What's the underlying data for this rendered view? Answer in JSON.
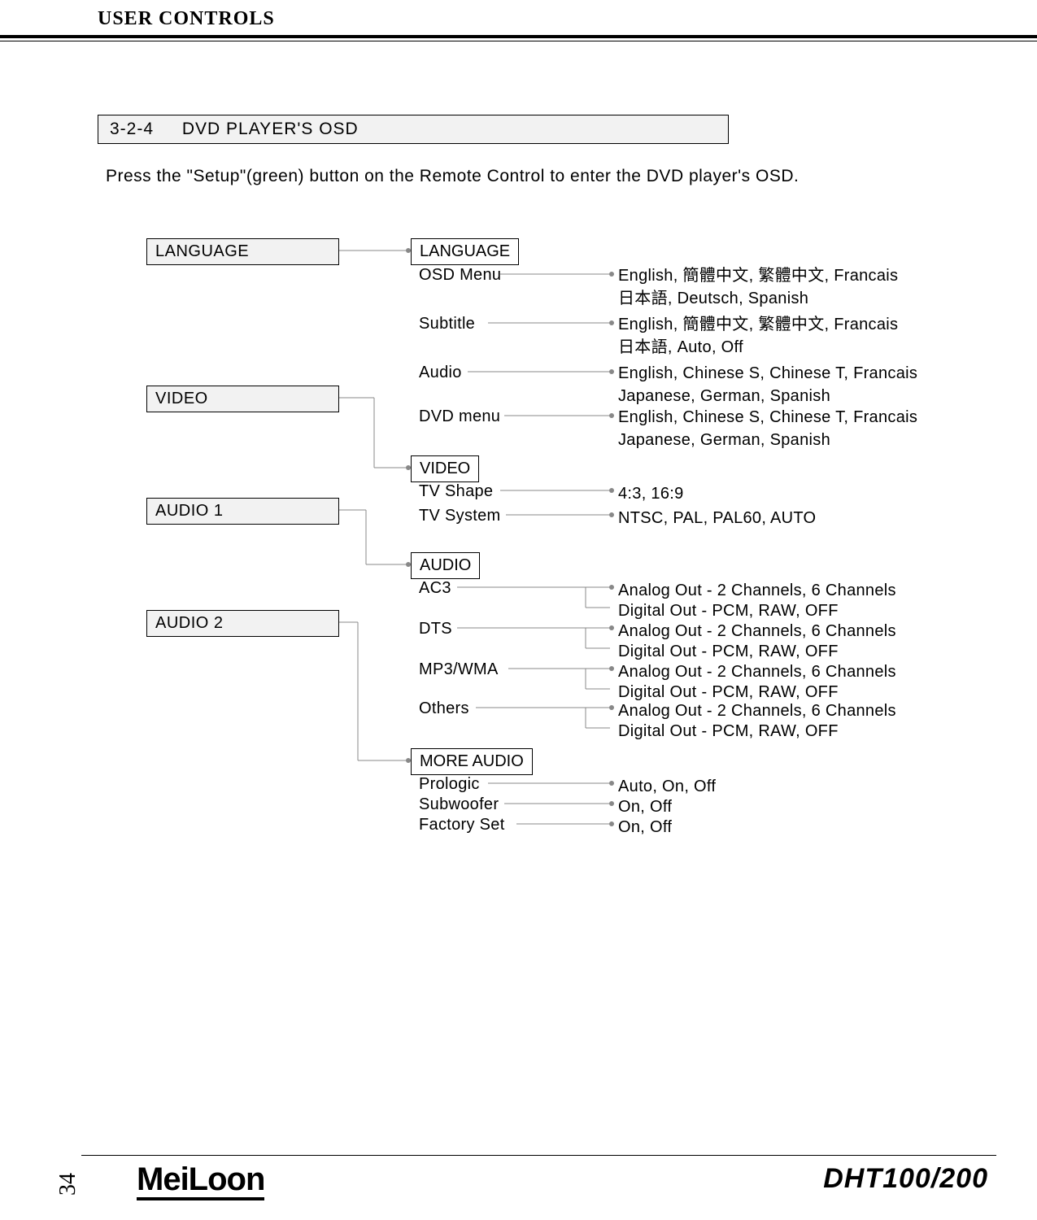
{
  "header": {
    "title": "USER CONTROLS"
  },
  "section": {
    "number": "3-2-4",
    "title": "DVD PLAYER'S OSD",
    "intro": "Press the \"Setup\"(green) button on the Remote Control to enter the DVD player's OSD."
  },
  "tabs": {
    "language": "LANGUAGE",
    "video": "VIDEO",
    "audio1": "AUDIO 1",
    "audio2": "AUDIO 2"
  },
  "groups": {
    "language": {
      "header": "LANGUAGE",
      "items": {
        "osd_menu": "OSD Menu",
        "subtitle": "Subtitle",
        "audio": "Audio",
        "dvd_menu": "DVD menu"
      },
      "values": {
        "osd_menu": "English, 簡體中文, 繁體中文, Francais\n日本語, Deutsch, Spanish",
        "subtitle": "English, 簡體中文, 繁體中文, Francais\n日本語, Auto, Off",
        "audio": "English, Chinese S, Chinese T, Francais\nJapanese, German, Spanish",
        "dvd_menu": "English, Chinese S, Chinese T, Francais\nJapanese, German, Spanish"
      }
    },
    "video": {
      "header": "VIDEO",
      "items": {
        "tv_shape": "TV Shape",
        "tv_system": "TV System"
      },
      "values": {
        "tv_shape": "4:3, 16:9",
        "tv_system": "NTSC, PAL, PAL60, AUTO"
      }
    },
    "audio": {
      "header": "AUDIO",
      "items": {
        "ac3": "AC3",
        "dts": "DTS",
        "mp3wma": "MP3/WMA",
        "others": "Others"
      },
      "values": {
        "ac3_a": "Analog Out - 2 Channels, 6 Channels",
        "ac3_d": "Digital Out - PCM, RAW, OFF",
        "dts_a": "Analog Out - 2 Channels, 6 Channels",
        "dts_d": "Digital Out - PCM, RAW, OFF",
        "mp3_a": "Analog Out - 2 Channels, 6 Channels",
        "mp3_d": "Digital Out - PCM, RAW, OFF",
        "oth_a": "Analog Out - 2 Channels, 6 Channels",
        "oth_d": "Digital Out - PCM, RAW, OFF"
      }
    },
    "more_audio": {
      "header": "MORE AUDIO",
      "items": {
        "prologic": "Prologic",
        "subwoofer": "Subwoofer",
        "factory": "Factory Set"
      },
      "values": {
        "prologic": "Auto, On, Off",
        "subwoofer": "On, Off",
        "factory": "On, Off"
      }
    }
  },
  "footer": {
    "page": "34",
    "brand": "MeiLoon",
    "model": "DHT100/200"
  }
}
